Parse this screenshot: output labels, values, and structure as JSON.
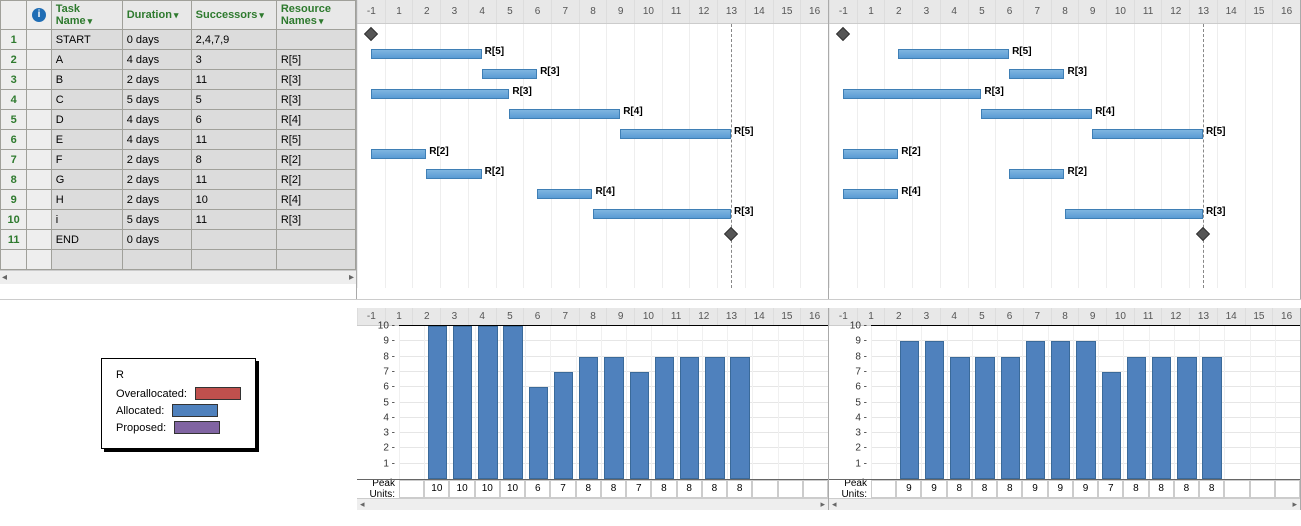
{
  "table": {
    "columns": [
      "Task Name",
      "Duration",
      "Successors",
      "Resource Names"
    ],
    "info_icon": "i",
    "rows": [
      {
        "n": 1,
        "name": "START",
        "dur": "0 days",
        "succ": "2,4,7,9",
        "res": ""
      },
      {
        "n": 2,
        "name": "A",
        "dur": "4 days",
        "succ": "3",
        "res": "R[5]"
      },
      {
        "n": 3,
        "name": "B",
        "dur": "2 days",
        "succ": "11",
        "res": "R[3]"
      },
      {
        "n": 4,
        "name": "C",
        "dur": "5 days",
        "succ": "5",
        "res": "R[3]"
      },
      {
        "n": 5,
        "name": "D",
        "dur": "4 days",
        "succ": "6",
        "res": "R[4]"
      },
      {
        "n": 6,
        "name": "E",
        "dur": "4 days",
        "succ": "11",
        "res": "R[5]"
      },
      {
        "n": 7,
        "name": "F",
        "dur": "2 days",
        "succ": "8",
        "res": "R[2]"
      },
      {
        "n": 8,
        "name": "G",
        "dur": "2 days",
        "succ": "11",
        "res": "R[2]"
      },
      {
        "n": 9,
        "name": "H",
        "dur": "2 days",
        "succ": "10",
        "res": "R[4]"
      },
      {
        "n": 10,
        "name": "i",
        "dur": "5 days",
        "succ": "11",
        "res": "R[3]"
      },
      {
        "n": 11,
        "name": "END",
        "dur": "0 days",
        "succ": "",
        "res": ""
      }
    ]
  },
  "timescale": {
    "start": -1,
    "end": 16
  },
  "gantt_left": {
    "finish_dash_day": 13.5,
    "bars": [
      {
        "type": "ms",
        "day": 0.5
      },
      {
        "s": 0.5,
        "e": 4.5,
        "label": "R[5]"
      },
      {
        "s": 4.5,
        "e": 6.5,
        "label": "R[3]"
      },
      {
        "s": 0.5,
        "e": 5.5,
        "label": "R[3]"
      },
      {
        "s": 5.5,
        "e": 9.5,
        "label": "R[4]"
      },
      {
        "s": 9.5,
        "e": 13.5,
        "label": "R[5]"
      },
      {
        "s": 0.5,
        "e": 2.5,
        "label": "R[2]"
      },
      {
        "s": 2.5,
        "e": 4.5,
        "label": "R[2]"
      },
      {
        "s": 6.5,
        "e": 8.5,
        "label": "R[4]"
      },
      {
        "s": 8.5,
        "e": 13.5,
        "label": "R[3]"
      },
      {
        "type": "ms",
        "day": 13.5
      }
    ]
  },
  "gantt_right": {
    "finish_dash_day": 13.5,
    "bars": [
      {
        "type": "ms",
        "day": 0.5
      },
      {
        "s": 2.5,
        "e": 6.5,
        "label": "R[5]"
      },
      {
        "s": 6.5,
        "e": 8.5,
        "label": "R[3]"
      },
      {
        "s": 0.5,
        "e": 5.5,
        "label": "R[3]"
      },
      {
        "s": 5.5,
        "e": 9.5,
        "label": "R[4]"
      },
      {
        "s": 9.5,
        "e": 13.5,
        "label": "R[5]"
      },
      {
        "s": 0.5,
        "e": 2.5,
        "label": "R[2]"
      },
      {
        "s": 6.5,
        "e": 8.5,
        "label": "R[2]"
      },
      {
        "s": 0.5,
        "e": 2.5,
        "label": "R[4]"
      },
      {
        "s": 8.5,
        "e": 13.5,
        "label": "R[3]"
      },
      {
        "type": "ms",
        "day": 13.5
      }
    ]
  },
  "legend": {
    "title": "R",
    "items": [
      {
        "label": "Overallocated:",
        "cls": "sw-over"
      },
      {
        "label": "Allocated:",
        "cls": "sw-alloc"
      },
      {
        "label": "Proposed:",
        "cls": "sw-prop"
      }
    ]
  },
  "chart_data": [
    {
      "type": "bar",
      "title": "Peak Units (left)",
      "categories": [
        -1,
        1,
        2,
        3,
        4,
        5,
        6,
        7,
        8,
        9,
        10,
        11,
        12,
        13,
        14,
        15,
        16
      ],
      "values": [
        0,
        10,
        10,
        10,
        10,
        6,
        7,
        8,
        8,
        7,
        8,
        8,
        8,
        8,
        0,
        0,
        0
      ],
      "ylim": [
        0,
        10
      ],
      "threshold": 10,
      "peak_label": "Peak Units:"
    },
    {
      "type": "bar",
      "title": "Peak Units (right)",
      "categories": [
        -1,
        1,
        2,
        3,
        4,
        5,
        6,
        7,
        8,
        9,
        10,
        11,
        12,
        13,
        14,
        15,
        16
      ],
      "values": [
        0,
        9,
        9,
        8,
        8,
        8,
        9,
        9,
        9,
        7,
        8,
        8,
        8,
        8,
        0,
        0,
        0
      ],
      "ylim": [
        0,
        10
      ],
      "threshold": 10,
      "peak_label": "Peak Units:"
    }
  ]
}
